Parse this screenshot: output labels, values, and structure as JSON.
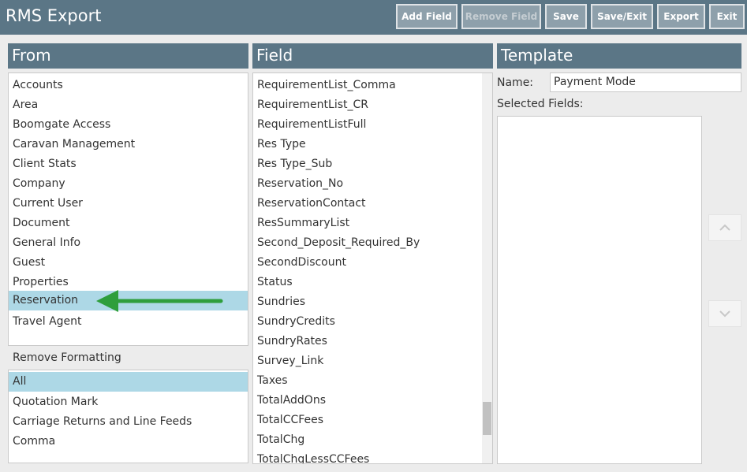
{
  "app": {
    "title": "RMS Export"
  },
  "toolbar": {
    "add_field": "Add Field",
    "remove_field": "Remove Field",
    "save": "Save",
    "save_exit": "Save/Exit",
    "export": "Export",
    "exit": "Exit"
  },
  "panels": {
    "from_title": "From",
    "field_title": "Field",
    "template_title": "Template"
  },
  "from_list": {
    "items": [
      "Accounts",
      "Area",
      "Boomgate Access",
      "Caravan Management",
      "Client Stats",
      "Company",
      "Current User",
      "Document",
      "General Info",
      "Guest",
      "Properties",
      "Reservation",
      "Travel Agent"
    ],
    "selected": "Reservation"
  },
  "remove_formatting": {
    "label": "Remove Formatting",
    "items": [
      "All",
      "Quotation Mark",
      "Carriage Returns and Line Feeds",
      "Comma"
    ],
    "selected": "All"
  },
  "field_list": {
    "items": [
      "RequirementList_Comma",
      "RequirementList_CR",
      "RequirementListFull",
      "Res Type",
      "Res Type_Sub",
      "Reservation_No",
      "ReservationContact",
      "ResSummaryList",
      "Second_Deposit_Required_By",
      "SecondDiscount",
      "Status",
      "Sundries",
      "SundryCredits",
      "SundryRates",
      "Survey_Link",
      "Taxes",
      "TotalAddOns",
      "TotalCCFees",
      "TotalChg",
      "TotalChgLessCCFees"
    ]
  },
  "template": {
    "name_label": "Name:",
    "name_value": "Payment Mode",
    "selected_fields_label": "Selected Fields:"
  },
  "icons": {
    "annotation_arrow": "arrow-left-icon",
    "move_up": "chevron-up-icon",
    "move_down": "chevron-down-icon"
  },
  "colors": {
    "header": "#5b7686",
    "selection": "#add8e6",
    "annotation_arrow": "#2e9e3c"
  }
}
